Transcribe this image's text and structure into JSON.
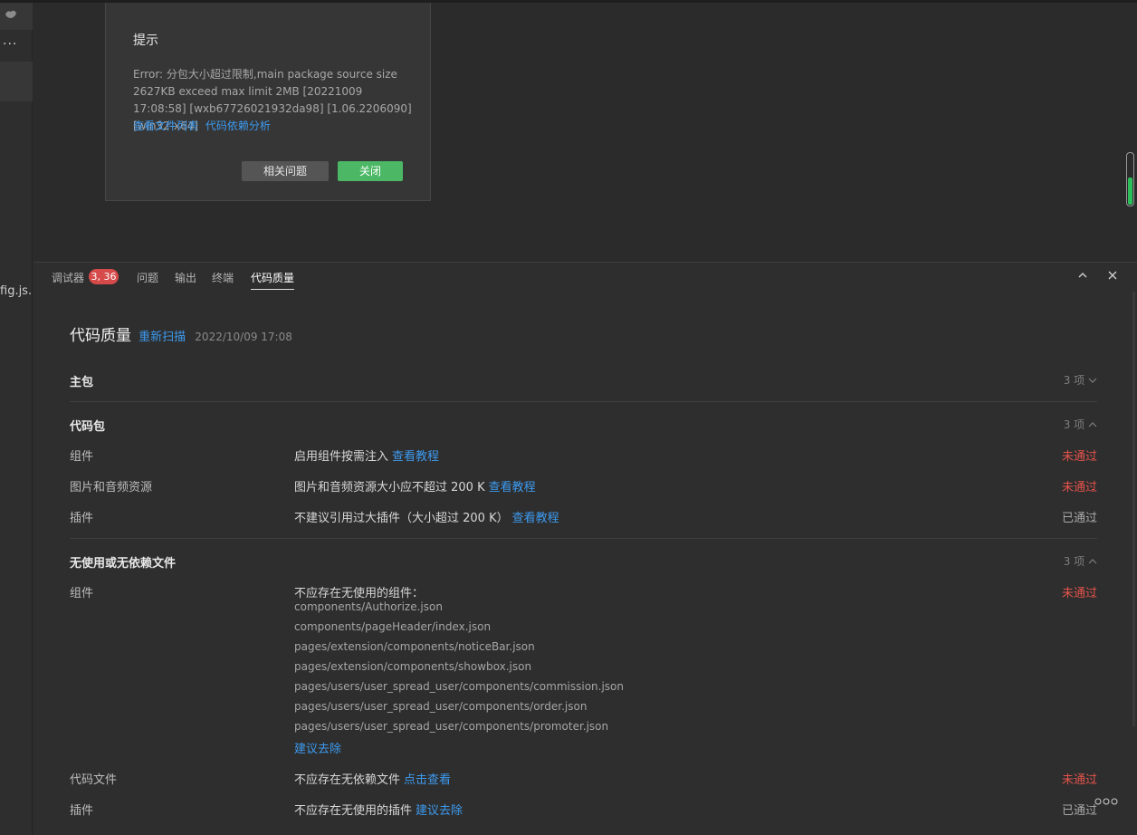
{
  "sidebar": {
    "dots": "...",
    "file_label": "fig.js..."
  },
  "dialog": {
    "title": "提示",
    "message": "Error: 分包大小超过限制,main package source size 2627KB exceed max limit 2MB [20221009 17:08:58] [wxb67726021932da98] [1.06.2206090][win32-x64]",
    "link_files": "查看文件列表",
    "link_deps": "代码依赖分析",
    "btn_related": "相关问题",
    "btn_close": "关闭"
  },
  "panel": {
    "tabs": {
      "debugger": "调试器",
      "badge": "3, 36",
      "issues": "问题",
      "output": "输出",
      "terminal": "终端",
      "quality": "代码质量"
    },
    "header": {
      "title": "代码质量",
      "rescan": "重新扫描",
      "timestamp": "2022/10/09 17:08"
    },
    "sections": {
      "main": {
        "name": "主包",
        "count": "3 项"
      },
      "code_pkg": {
        "name": "代码包",
        "count": "3 项",
        "rows": [
          {
            "name": "组件",
            "desc": "启用组件按需注入",
            "link": "查看教程",
            "status": "未通过"
          },
          {
            "name": "图片和音频资源",
            "desc": "图片和音频资源大小应不超过 200 K",
            "link": "查看教程",
            "status": "未通过"
          },
          {
            "name": "插件",
            "desc": "不建议引用过大插件（大小超过 200 K）",
            "link": "查看教程",
            "status": "已通过"
          }
        ]
      },
      "unused": {
        "name": "无使用或无依赖文件",
        "count": "3 项",
        "component_row": {
          "name": "组件",
          "desc": "不应存在无使用的组件：",
          "status": "未通过",
          "files": [
            "components/Authorize.json",
            "components/pageHeader/index.json",
            "pages/extension/components/noticeBar.json",
            "pages/extension/components/showbox.json",
            "pages/users/user_spread_user/components/commission.json",
            "pages/users/user_spread_user/components/order.json",
            "pages/users/user_spread_user/components/promoter.json"
          ],
          "action": "建议去除"
        },
        "code_row": {
          "name": "代码文件",
          "desc": "不应存在无依赖文件",
          "link": "点击查看",
          "status": "未通过"
        },
        "plugin_row": {
          "name": "插件",
          "desc": "不应存在无使用的插件",
          "link": "建议去除",
          "status": "已通过"
        }
      }
    }
  },
  "colors": {
    "link": "#3d9aef",
    "fail": "#e5534b",
    "confirm": "#4cb865",
    "badge": "#d64a4a"
  }
}
